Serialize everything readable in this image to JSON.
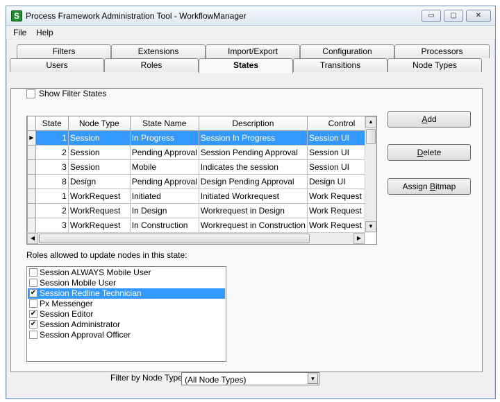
{
  "window": {
    "title": "Process Framework Administration Tool - WorkflowManager",
    "app_icon": "S",
    "minimize_glyph": "▭",
    "maximize_glyph": "▢",
    "close_glyph": "✕"
  },
  "menu": {
    "file": "File",
    "help": "Help"
  },
  "tabs": {
    "row1": [
      "Filters",
      "Extensions",
      "Import/Export",
      "Configuration",
      "Processors"
    ],
    "row2": [
      "Users",
      "Roles",
      "States",
      "Transitions",
      "Node Types"
    ],
    "active": "States"
  },
  "show_filter_states": {
    "label": "Show Filter States",
    "checked": false
  },
  "grid": {
    "columns": [
      "State",
      "Node Type",
      "State Name",
      "Description",
      "Control"
    ],
    "current_row_glyph": "▶",
    "rows": [
      {
        "state": "1",
        "node_type": "Session",
        "state_name": "In Progress",
        "description": "Session In Progress",
        "control": "Session UI",
        "selected": true
      },
      {
        "state": "2",
        "node_type": "Session",
        "state_name": "Pending Approval",
        "description": "Session Pending Approval",
        "control": "Session UI"
      },
      {
        "state": "3",
        "node_type": "Session",
        "state_name": "Mobile",
        "description": "Indicates the session",
        "control": "Session UI"
      },
      {
        "state": "8",
        "node_type": "Design",
        "state_name": "Pending Approval",
        "description": "Design Pending Approval",
        "control": "Design UI"
      },
      {
        "state": "1",
        "node_type": "WorkRequest",
        "state_name": "Initiated",
        "description": "Initiated Workrequest",
        "control": "Work Request UI"
      },
      {
        "state": "2",
        "node_type": "WorkRequest",
        "state_name": "In Design",
        "description": "Workrequest in Design",
        "control": "Work Request UI"
      },
      {
        "state": "3",
        "node_type": "WorkRequest",
        "state_name": "In Construction",
        "description": "Workrequest in Construction",
        "control": "Work Request UI"
      }
    ],
    "scroll_up": "▲",
    "scroll_down": "▼",
    "scroll_left": "◀",
    "scroll_right": "▶"
  },
  "buttons": {
    "add": {
      "accel": "A",
      "rest": "dd"
    },
    "delete": {
      "accel": "D",
      "rest": "elete"
    },
    "assign_bitmap": {
      "pre": "Assign ",
      "accel": "B",
      "rest": "itmap"
    }
  },
  "roles": {
    "label": "Roles allowed to update nodes in this state:",
    "items": [
      {
        "name": "Session ALWAYS Mobile User",
        "checked": false
      },
      {
        "name": "Session Mobile User",
        "checked": false
      },
      {
        "name": "Session Redline Technician",
        "checked": true,
        "selected": true
      },
      {
        "name": "Px Messenger",
        "checked": false
      },
      {
        "name": "Session Editor",
        "checked": true
      },
      {
        "name": "Session Administrator",
        "checked": true
      },
      {
        "name": "Session Approval Officer",
        "checked": false
      }
    ],
    "check_glyph": "✔"
  },
  "filter": {
    "label": "Filter by Node Type:",
    "value": "(All Node Types)",
    "arrow": "▼"
  }
}
